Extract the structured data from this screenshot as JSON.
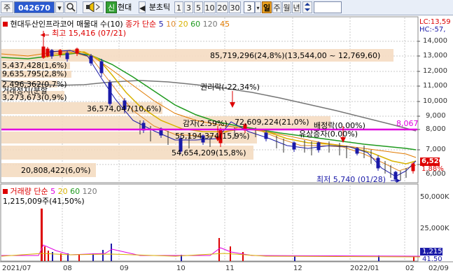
{
  "toolbar": {
    "mode_label": "주",
    "code_value": "042670",
    "search_icon": "search-icon",
    "sound_icon": "speaker-icon",
    "new_badge": "신",
    "stock_name": "현대",
    "tick_prev": "◀",
    "tick_label": "분초틱",
    "tick_values": [
      "1",
      "3",
      "5",
      "10",
      "20",
      "30"
    ],
    "period_value": "3",
    "period_selected": "일",
    "period_items": [
      "주",
      "월",
      "년"
    ],
    "extra_icon": "updown-arrow-icon"
  },
  "price_panel": {
    "legend_name": "현대두산인프라코어 매물대 수(10)",
    "legend_ma_label": "종가 단순",
    "legend_ma": [
      {
        "label": "5",
        "color": "#1a1aa8"
      },
      {
        "label": "10",
        "color": "#e08a2a"
      },
      {
        "label": "20",
        "color": "#d8b200"
      },
      {
        "label": "60",
        "color": "#1f9a1f"
      },
      {
        "label": "120",
        "color": "#777777"
      },
      {
        "label": "45",
        "color": "#e07a00"
      }
    ],
    "lc_label": "LC:13,59",
    "hc_label": "HC:-57,",
    "y_ticks": [
      "14,000",
      "13,000",
      "12,000",
      "11,000",
      "10,000",
      "9,000",
      "8,000",
      "7,000",
      "6,000"
    ],
    "current_price": "6,520",
    "change_pct": "1.88%",
    "hline_value": "8,067",
    "annotations": {
      "high": "최고 15,416 (07/21)",
      "low": "최저 5,740 (01/28)",
      "rights": "권리락(-22.34%)",
      "reduction": "감자(2.59%)",
      "ex_rights": "배정락(0.00%)",
      "free_issue": "유상증자(0.00%)",
      "merger_prefix": "거래정지(분할",
      "vol_bands": [
        "85,719,296(24,8%)(13,544,00 ~ 12,769,60)",
        "5,437,428(1,6%)",
        "9,635,795(2,8%)",
        "2,496,362(0,7%)",
        "3,273,673(0,9%)",
        "36,574,047(10,6%)",
        "72,609,224(21,0%)",
        "55,194,374(15,9%)",
        "54,654,209(15,8%)",
        "20,808,422(6,0%)"
      ]
    }
  },
  "volume_panel": {
    "legend_name": "거래량 단순",
    "legend_ma": [
      {
        "label": "5",
        "color": "#e000e0"
      },
      {
        "label": "20",
        "color": "#d8b200"
      },
      {
        "label": "60",
        "color": "#1f9a1f"
      },
      {
        "label": "120",
        "color": "#777777"
      }
    ],
    "max_label": "1,215,009주(41,50%)",
    "y_ticks": [
      "50,000K",
      "25,000K"
    ],
    "current_volume": "1,215K",
    "current_pct": "41.50"
  },
  "x_axis": [
    "2021/07",
    "08",
    "09",
    "10",
    "11",
    "12",
    "2022/01",
    "02",
    "02/09"
  ]
}
